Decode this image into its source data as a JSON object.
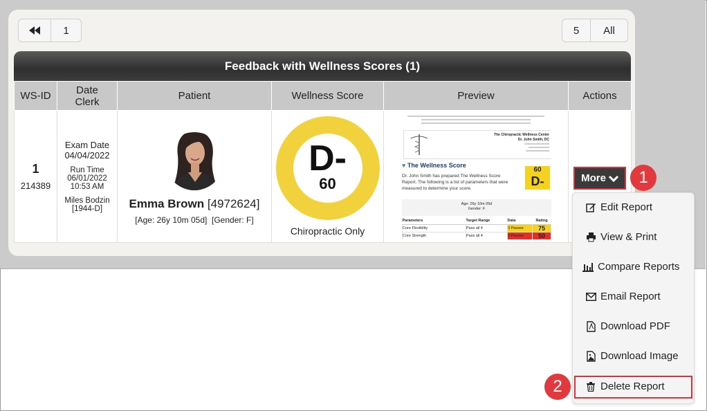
{
  "pagination": {
    "first_icon": "rewind-icon",
    "page_1": "1",
    "size_5": "5",
    "size_all": "All"
  },
  "table": {
    "title": "Feedback with Wellness Scores (1)",
    "headers": {
      "wsid": "WS-ID",
      "date_line1": "Date",
      "date_line2": "Clerk",
      "patient": "Patient",
      "score": "Wellness Score",
      "preview": "Preview",
      "actions": "Actions"
    },
    "row": {
      "wsid": "1",
      "wsid_sub": "214389",
      "exam_label": "Exam Date",
      "exam_date": "04/04/2022",
      "run_label": "Run Time",
      "run_date": "06/01/2022",
      "run_time": "10:53 AM",
      "clerk_name": "Miles Bodzin",
      "clerk_code": "[1944-D]",
      "patient_name": "Emma Brown",
      "patient_id": "[4972624]",
      "patient_info": "[Age: 26y 10m 05d]  [Gender: F]",
      "grade": "D-",
      "score": "60",
      "score_caption": "Chiropractic Only",
      "preview": {
        "clinic_name": "The Chiropractic Wellness Center",
        "doctor": "Dr. John Smith, DC",
        "heading": "The Wellness Score",
        "intro": "Dr. John Smith has prepared The Wellness Score Report. The following is a list of parameters that were measured to determine your score.",
        "badge_score": "60",
        "badge_grade": "D-",
        "age_line": "Age: 26y 10m 05d",
        "gender_line": "Gender: F",
        "col_params": "Parameters",
        "col_target": "Target Range",
        "col_data": "Data",
        "col_rating": "Rating",
        "rows": [
          {
            "param": "Core Flexibility",
            "target": "Pass all 4",
            "data": "3 Passes",
            "rating": "75"
          },
          {
            "param": "Core Strength",
            "target": "Pass all 4",
            "data": "2 Passes",
            "rating": "50"
          }
        ]
      }
    }
  },
  "actions": {
    "more_label": "More",
    "callout_1": "1",
    "callout_2": "2",
    "menu": [
      {
        "label": "Edit Report",
        "icon": "edit-icon"
      },
      {
        "label": "View & Print",
        "icon": "printer-icon"
      },
      {
        "label": "Compare Reports",
        "icon": "compare-icon"
      },
      {
        "label": "Email Report",
        "icon": "envelope-icon"
      },
      {
        "label": "Download PDF",
        "icon": "pdf-icon"
      },
      {
        "label": "Download Image",
        "icon": "image-icon"
      },
      {
        "label": "Delete Report",
        "icon": "trash-icon"
      }
    ]
  },
  "colors": {
    "score_ring": "#f2d23c",
    "callout": "#e03a3e",
    "title_bar": "#3a3a3a"
  }
}
